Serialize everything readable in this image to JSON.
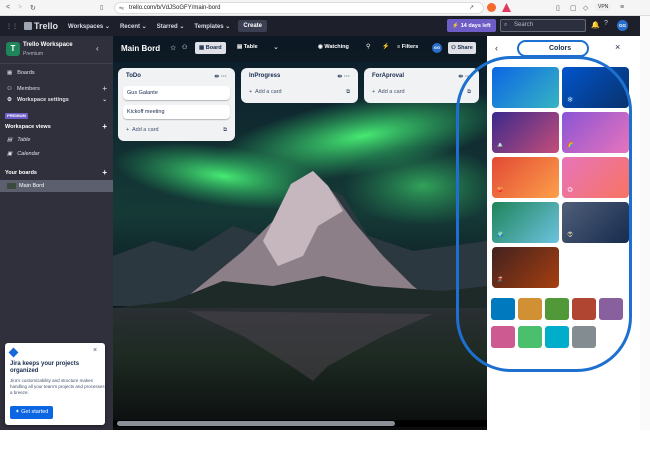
{
  "browser": {
    "url": "trello.com/b/VdJSoGFY/main-bord",
    "vpn": "VPN"
  },
  "header": {
    "logo": "Trello",
    "nav": [
      "Workspaces",
      "Recent",
      "Starred",
      "Templates"
    ],
    "create": "Create",
    "trial": "14 days left",
    "search_placeholder": "Search",
    "avatar": "GG"
  },
  "sidebar": {
    "workspace_name": "Trello Workspace",
    "workspace_plan": "Premium",
    "workspace_initial": "T",
    "items": [
      "Boards",
      "Members",
      "Workspace settings"
    ],
    "premium_badge": "PREMIUM",
    "views_heading": "Workspace views",
    "views": [
      "Table",
      "Calendar"
    ],
    "boards_heading": "Your boards",
    "boards": [
      "Main Bord"
    ]
  },
  "board": {
    "title": "Main Bord",
    "view_board": "Board",
    "view_table": "Table",
    "watching": "Watching",
    "filters": "Filters",
    "share": "Share",
    "member_initials": "GG",
    "lists": [
      {
        "title": "ToDo",
        "cards": [
          "Gus Galante",
          "Kickoff meeting"
        ],
        "add": "Add a card"
      },
      {
        "title": "InProgress",
        "cards": [],
        "add": "Add a card"
      },
      {
        "title": "ForAproval",
        "cards": [],
        "add": "Add a card"
      }
    ]
  },
  "panel": {
    "title": "Colors",
    "gradients": [
      {
        "from": "#0c66e4",
        "to": "#37b4c3",
        "emoji": ""
      },
      {
        "from": "#0055cc",
        "to": "#09326c",
        "emoji": "❄️"
      },
      {
        "from": "#3a2a8c",
        "to": "#c54d7a",
        "emoji": "🏔️"
      },
      {
        "from": "#8a54d6",
        "to": "#e774bb",
        "emoji": "🌈"
      },
      {
        "from": "#e34935",
        "to": "#fca04a",
        "emoji": "🍑"
      },
      {
        "from": "#e774bb",
        "to": "#f87462",
        "emoji": "🌸"
      },
      {
        "from": "#1f845a",
        "to": "#6cc3e0",
        "emoji": "🌍"
      },
      {
        "from": "#505f79",
        "to": "#172b4d",
        "emoji": "👽"
      },
      {
        "from": "#42221f",
        "to": "#a73e0f",
        "emoji": "🌋"
      }
    ],
    "solids": [
      "#0079bf",
      "#d29034",
      "#519839",
      "#b04632",
      "#89609e",
      "#cd5a91",
      "#4bbf6b",
      "#00aecc",
      "#838c91"
    ]
  },
  "jira": {
    "heading": "Jira keeps your projects organized",
    "body": "Jira's customizability and structure makes handling all your team's projects and processes a breeze.",
    "cta": "Get started"
  }
}
